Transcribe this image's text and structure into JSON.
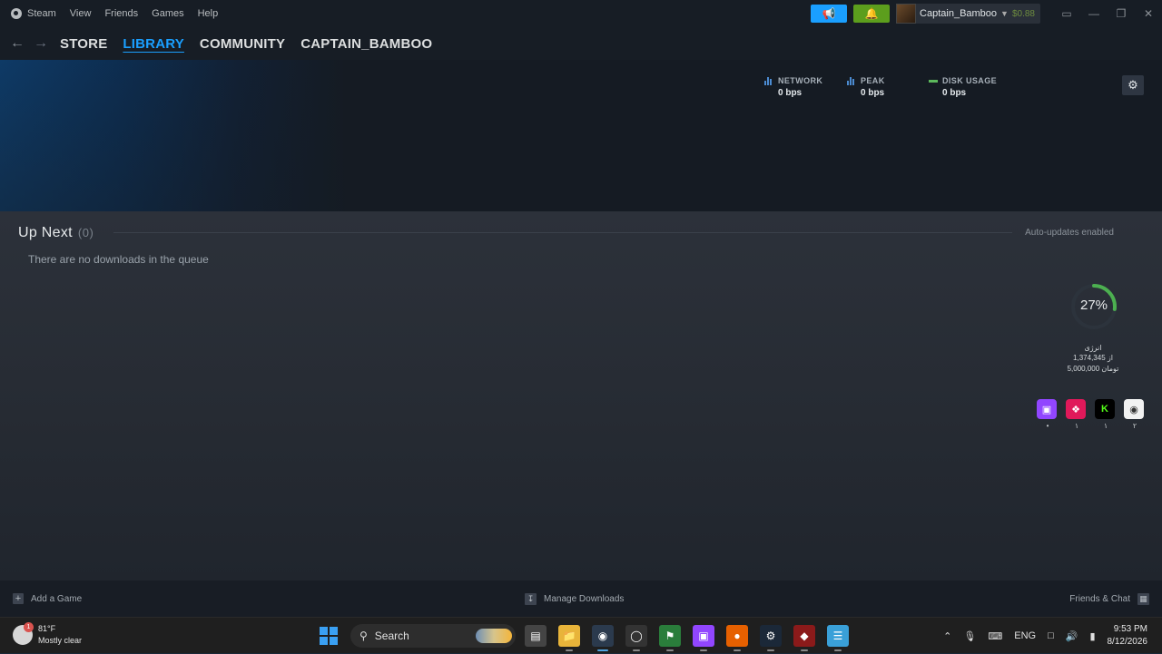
{
  "menu": {
    "steam": "Steam",
    "view": "View",
    "friends": "Friends",
    "games": "Games",
    "help": "Help"
  },
  "account": {
    "name": "Captain_Bamboo",
    "balance": "$0.88"
  },
  "nav": {
    "store": "STORE",
    "library": "LIBRARY",
    "community": "COMMUNITY",
    "profile": "CAPTAIN_BAMBOO"
  },
  "stats": {
    "network_label": "NETWORK",
    "network_value": "0 bps",
    "peak_label": "PEAK",
    "peak_value": "0 bps",
    "disk_label": "DISK USAGE",
    "disk_value": "0 bps"
  },
  "queue": {
    "title": "Up Next",
    "count": "(0)",
    "auto_updates": "Auto-updates enabled",
    "empty": "There are no downloads in the queue"
  },
  "widget": {
    "percent": "27%",
    "progress": 0.27,
    "line1": "انرژی",
    "line2": "1,374,345 از",
    "line3": "5,000,000 تومان",
    "counts": [
      "•",
      "١",
      "١",
      "٢"
    ]
  },
  "footer": {
    "add_game": "Add a Game",
    "manage_downloads": "Manage Downloads",
    "friends_chat": "Friends & Chat"
  },
  "taskbar": {
    "temp": "81°F",
    "condition": "Mostly clear",
    "weather_badge": "1",
    "search": "Search",
    "lang": "ENG",
    "time": "9:53 PM",
    "date": "8/12/2026"
  },
  "colors": {
    "accent": "#1a9fff",
    "notify": "#5c9e1d",
    "ring": "#4caf50"
  }
}
